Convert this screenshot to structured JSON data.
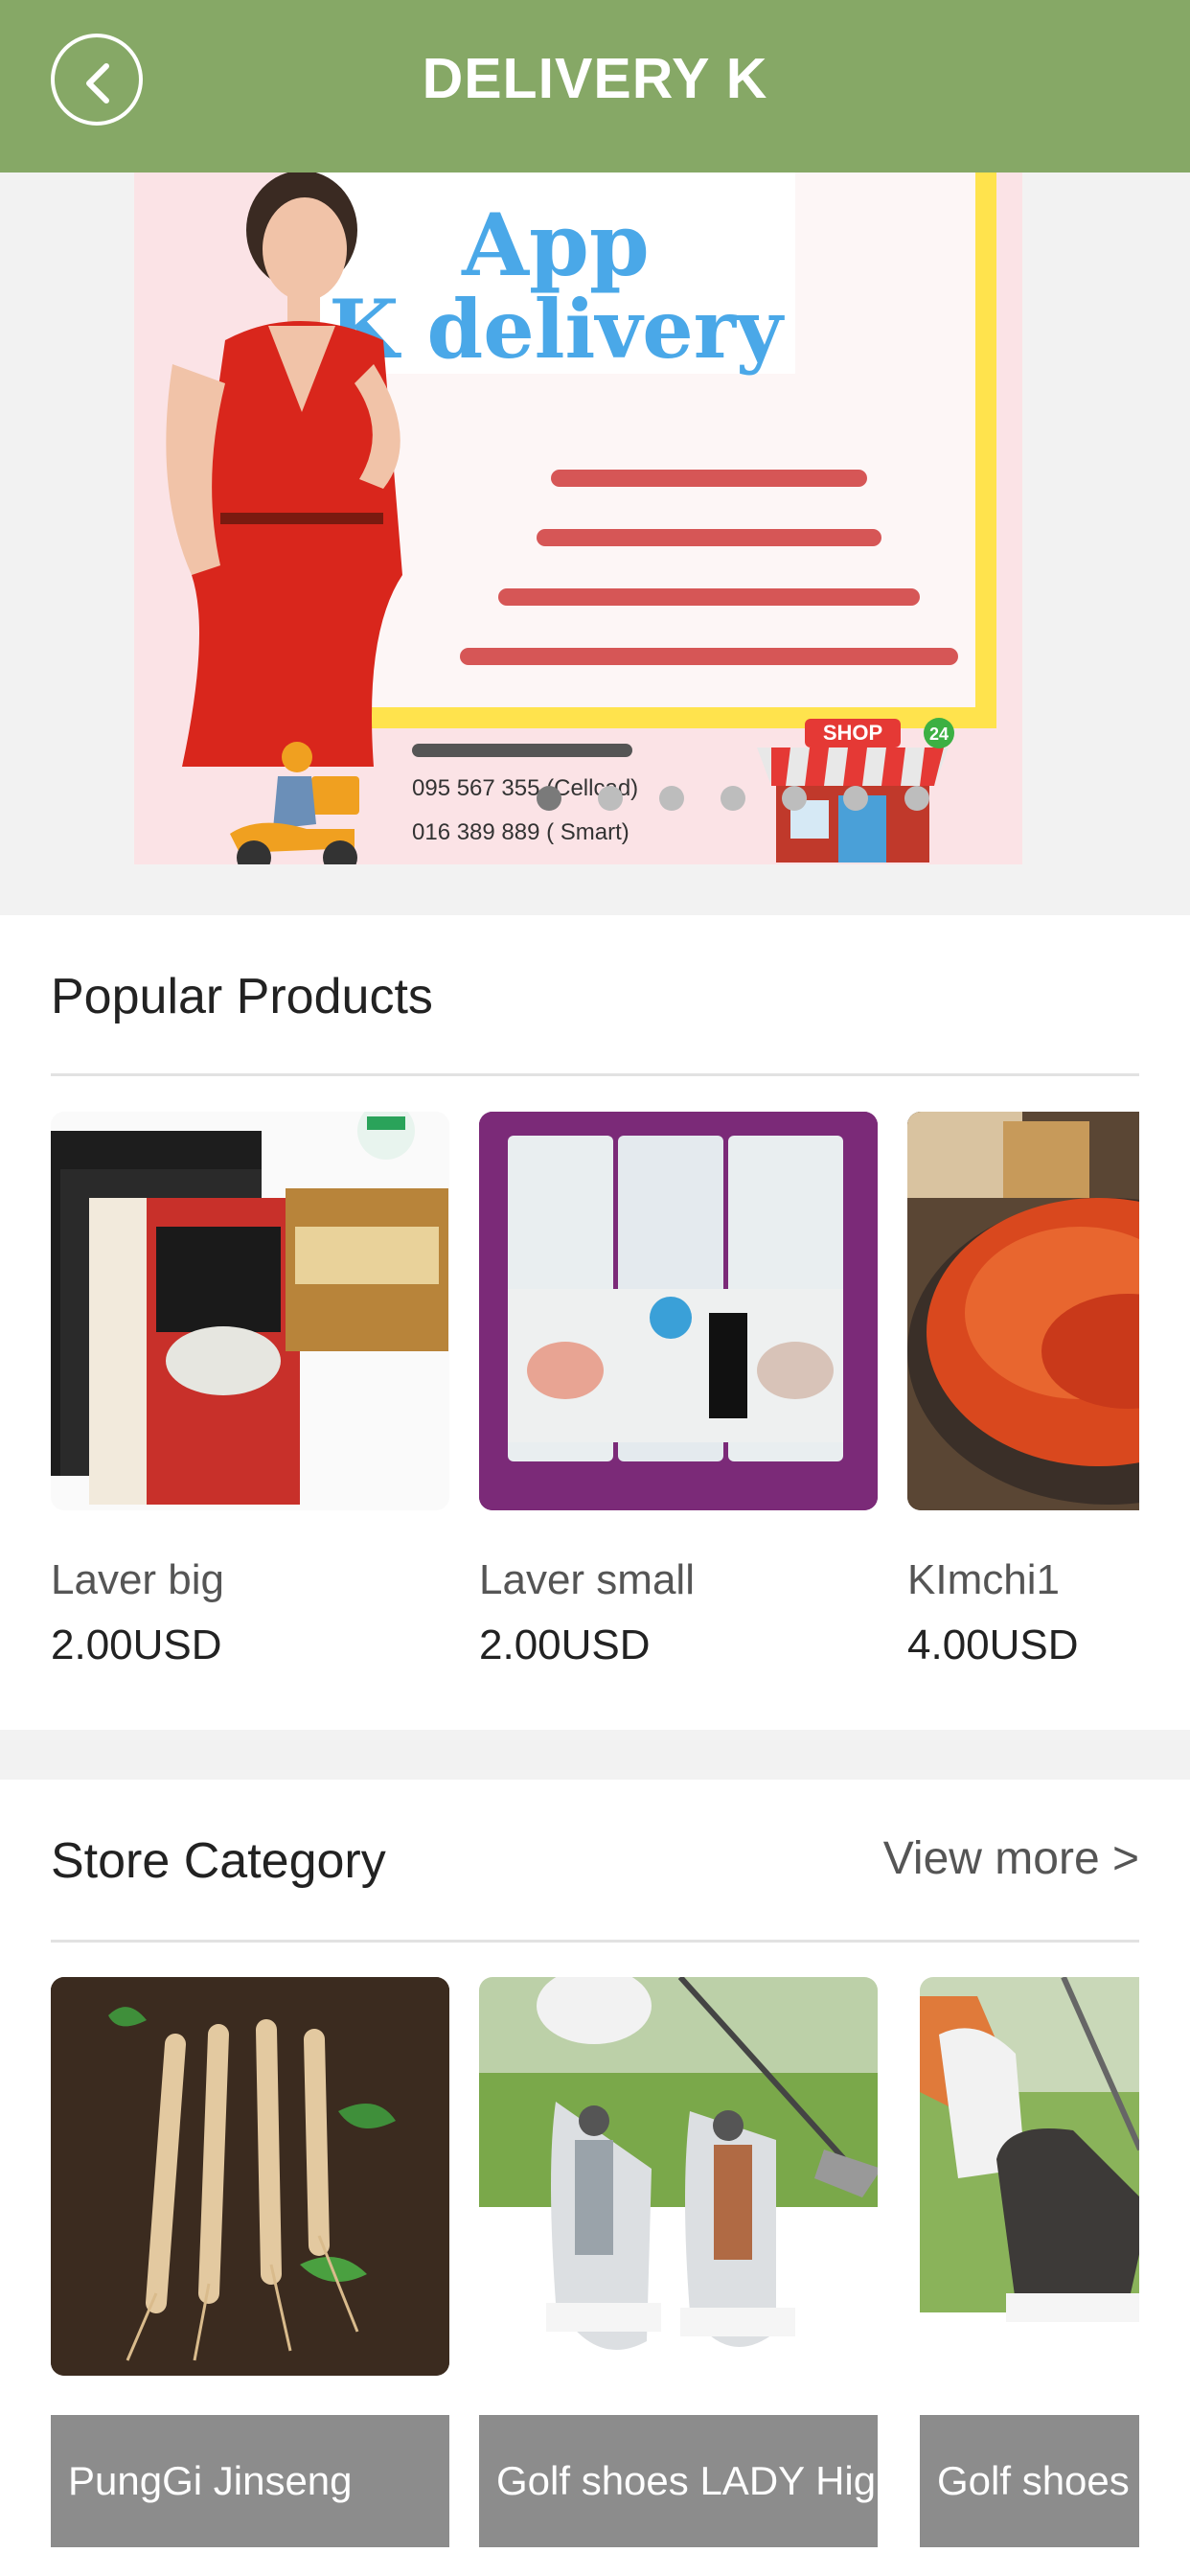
{
  "header": {
    "title": "DELIVERY K",
    "back_icon": "chevron-left-icon",
    "background": "#86a866"
  },
  "banner": {
    "line1": "App",
    "line2": "K delivery",
    "phone1": "095 567 355 (Cellcad)",
    "phone2": "016 389 889 ( Smart)",
    "shop_sign": "SHOP",
    "shop_badge": "24",
    "slide_count": 7,
    "active_slide": 0
  },
  "popular": {
    "title": "Popular Products",
    "products": [
      {
        "name": "Laver big",
        "price": "2.00USD"
      },
      {
        "name": "Laver small",
        "price": "2.00USD"
      },
      {
        "name": "KImchi1",
        "price": "4.00USD"
      }
    ]
  },
  "store_category": {
    "title": "Store Category",
    "view_more": "View more >",
    "categories": [
      {
        "label": "PungGi Jinseng"
      },
      {
        "label": "Golf shoes LADY High"
      },
      {
        "label": "Golf shoes MEN"
      }
    ]
  }
}
